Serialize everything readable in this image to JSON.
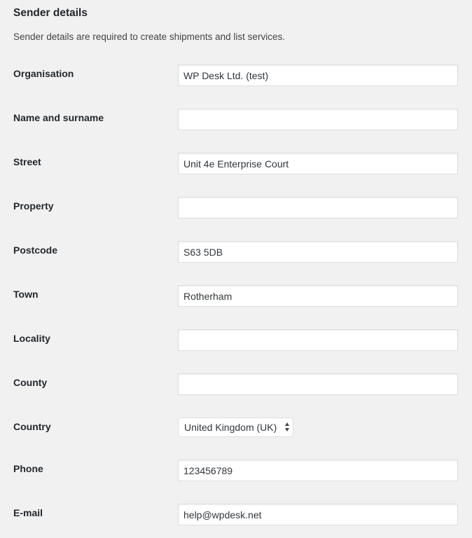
{
  "section": {
    "title": "Sender details",
    "description": "Sender details are required to create shipments and list services."
  },
  "fields": {
    "organisation": {
      "label": "Organisation",
      "value": "WP Desk Ltd. (test)"
    },
    "name": {
      "label": "Name and surname",
      "value": ""
    },
    "street": {
      "label": "Street",
      "value": "Unit 4e Enterprise Court"
    },
    "property": {
      "label": "Property",
      "value": ""
    },
    "postcode": {
      "label": "Postcode",
      "value": "S63 5DB"
    },
    "town": {
      "label": "Town",
      "value": "Rotherham"
    },
    "locality": {
      "label": "Locality",
      "value": ""
    },
    "county": {
      "label": "County",
      "value": ""
    },
    "country": {
      "label": "Country",
      "value": "United Kingdom (UK)"
    },
    "phone": {
      "label": "Phone",
      "value": "123456789"
    },
    "email": {
      "label": "E-mail",
      "value": "help@wpdesk.net"
    }
  }
}
